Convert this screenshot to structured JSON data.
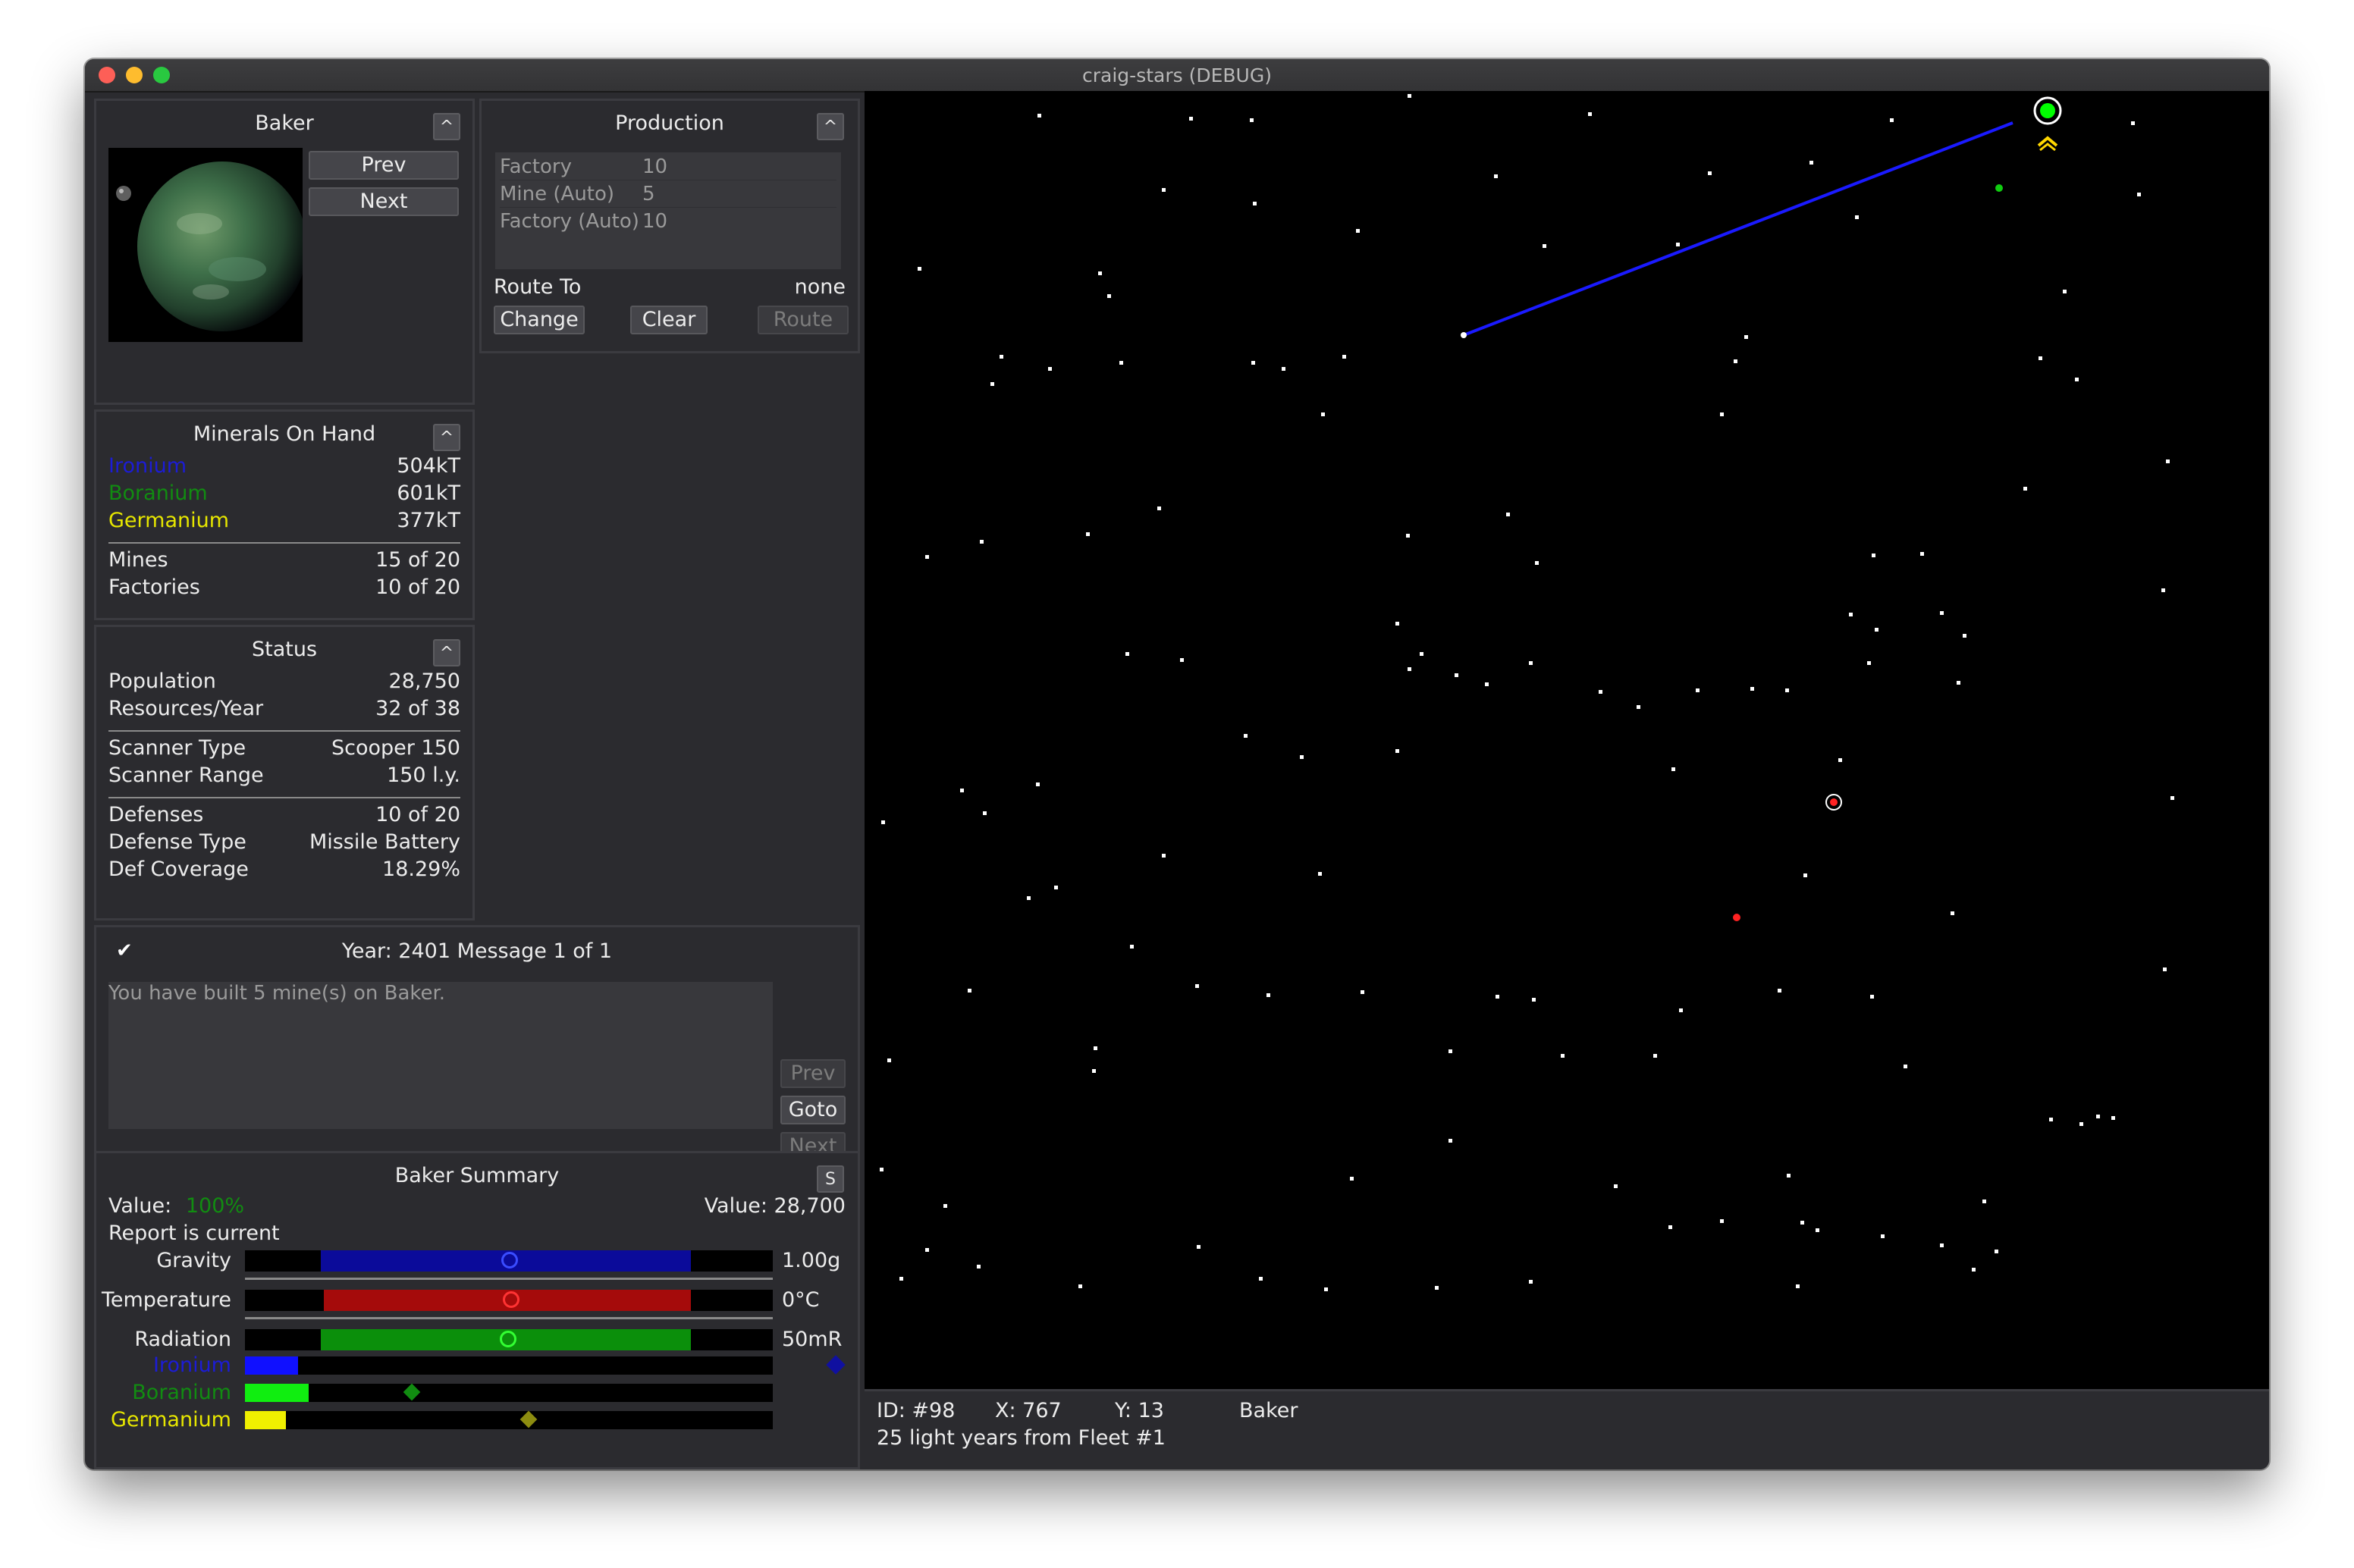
{
  "window": {
    "title": "craig-stars (DEBUG)"
  },
  "planet": {
    "name": "Baker",
    "prev_label": "Prev",
    "next_label": "Next",
    "collapse_label": "^"
  },
  "production": {
    "title": "Production",
    "collapse_label": "^",
    "queue": [
      {
        "name": "Factory",
        "qty": "10"
      },
      {
        "name": "Mine (Auto)",
        "qty": "5"
      },
      {
        "name": "Factory (Auto)",
        "qty": "10"
      }
    ],
    "route_label": "Route To",
    "route_value": "none",
    "change_label": "Change",
    "clear_label": "Clear",
    "route_button_label": "Route"
  },
  "minerals": {
    "title": "Minerals On Hand",
    "collapse_label": "^",
    "ironium_label": "Ironium",
    "ironium_value": "504kT",
    "boranium_label": "Boranium",
    "boranium_value": "601kT",
    "germanium_label": "Germanium",
    "germanium_value": "377kT",
    "mines_label": "Mines",
    "mines_value": "15 of 20",
    "factories_label": "Factories",
    "factories_value": "10 of 20",
    "colors": {
      "ironium": "#1c1cd6",
      "boranium": "#118c11",
      "germanium": "#e6e600"
    }
  },
  "status": {
    "title": "Status",
    "collapse_label": "^",
    "population_label": "Population",
    "population_value": "28,750",
    "resources_label": "Resources/Year",
    "resources_value": "32 of 38",
    "scanner_type_label": "Scanner Type",
    "scanner_type_value": "Scooper 150",
    "scanner_range_label": "Scanner Range",
    "scanner_range_value": "150 l.y.",
    "defenses_label": "Defenses",
    "defenses_value": "10 of 20",
    "defense_type_label": "Defense Type",
    "defense_type_value": "Missile Battery",
    "def_coverage_label": "Def Coverage",
    "def_coverage_value": "18.29%"
  },
  "messages": {
    "check": "✔",
    "header": "Year: 2401 Message 1 of 1",
    "body": "You have built 5 mine(s) on Baker.",
    "prev_label": "Prev",
    "goto_label": "Goto",
    "next_label": "Next"
  },
  "summary": {
    "title": "Baker Summary",
    "s_button": "S",
    "value_label": "Value:",
    "value_pct": "100%",
    "value_right": "Value: 28,700",
    "report": "Report is current",
    "gravity_label": "Gravity",
    "gravity_value": "1.00g",
    "temperature_label": "Temperature",
    "temperature_value": "0°C",
    "radiation_label": "Radiation",
    "radiation_value": "50mR",
    "ironium_label": "Ironium",
    "boranium_label": "Boranium",
    "germanium_label": "Germanium",
    "mineral_concentration": {
      "ironium": 0.1,
      "boranium": 0.12,
      "germanium": 0.08
    },
    "colors": {
      "gravity": "#0b0b9a",
      "temperature": "#a50b0b",
      "radiation": "#0b8f0b"
    }
  },
  "mapinfo": {
    "id": "ID: #98",
    "x": "X: 767",
    "y": "Y: 13",
    "name": "Baker",
    "distance": "25 light years from Fleet #1"
  }
}
